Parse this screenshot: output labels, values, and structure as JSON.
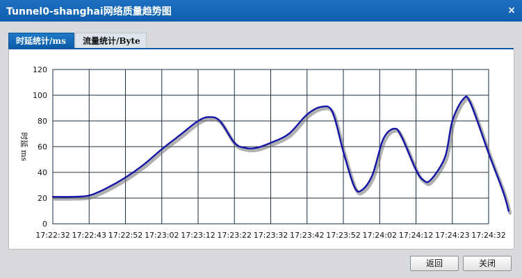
{
  "window": {
    "title": "Tunnel0-shanghai网络质量趋势图",
    "close_glyph": "×"
  },
  "tabs": [
    {
      "label": "时延统计/ms",
      "active": true
    },
    {
      "label": "流量统计/Byte",
      "active": false
    }
  ],
  "buttons": {
    "back": "返回",
    "close": "关闭"
  },
  "chart_data": {
    "type": "line",
    "ylabel": "时延 ms",
    "ylim": [
      0,
      120
    ],
    "y_ticks": [
      0,
      20,
      40,
      60,
      80,
      100,
      120
    ],
    "x_ticks": [
      "17:22:32",
      "17:22:43",
      "17:22:52",
      "17:23:02",
      "17:23:12",
      "17:23:22",
      "17:23:32",
      "17:23:42",
      "17:23:52",
      "17:24:02",
      "17:24:12",
      "17:24:23",
      "17:24:32"
    ],
    "grid": true,
    "series": [
      {
        "color": "#1414a8",
        "points": [
          [
            0,
            21
          ],
          [
            0.5,
            21
          ],
          [
            1,
            22
          ],
          [
            1.5,
            28
          ],
          [
            2,
            36
          ],
          [
            2.5,
            46
          ],
          [
            3,
            58
          ],
          [
            3.5,
            69
          ],
          [
            4,
            80
          ],
          [
            4.3,
            83
          ],
          [
            4.6,
            80
          ],
          [
            5,
            63
          ],
          [
            5.3,
            59
          ],
          [
            5.6,
            59
          ],
          [
            6,
            63
          ],
          [
            6.5,
            70
          ],
          [
            7,
            85
          ],
          [
            7.4,
            91
          ],
          [
            7.7,
            87
          ],
          [
            8,
            56
          ],
          [
            8.3,
            29
          ],
          [
            8.5,
            26
          ],
          [
            8.8,
            38
          ],
          [
            9.1,
            66
          ],
          [
            9.4,
            74
          ],
          [
            9.6,
            68
          ],
          [
            10,
            42
          ],
          [
            10.2,
            34
          ],
          [
            10.4,
            34
          ],
          [
            10.8,
            52
          ],
          [
            11,
            80
          ],
          [
            11.3,
            97
          ],
          [
            11.5,
            94
          ],
          [
            12,
            55
          ],
          [
            12.4,
            25
          ],
          [
            12.55,
            10
          ]
        ]
      }
    ]
  }
}
